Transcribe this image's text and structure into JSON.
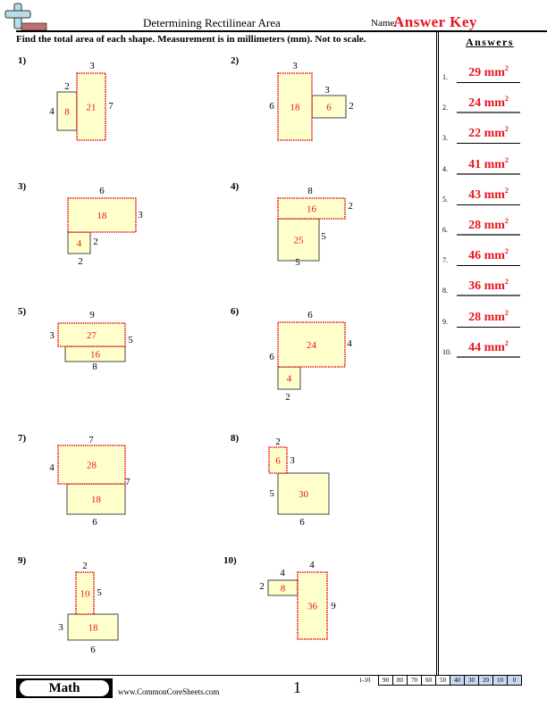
{
  "header": {
    "title": "Determining Rectilinear Area",
    "name_label": "Name:",
    "name_value": "Answer Key",
    "logo_icon": "plus-and-minus-blocks-icon"
  },
  "instructions": "Find the total area of each shape. Measurement is in millimeters (mm). Not to scale.",
  "colors": {
    "accent_red": "#e8141e",
    "shape_fill": "#ffffcc",
    "score_highlight": "#c6d9f1"
  },
  "problems": [
    {
      "label": "1)",
      "rects": [
        {
          "area": "21",
          "highlight": true
        },
        {
          "area": "8",
          "highlight": false
        }
      ],
      "dims": [
        "3",
        "2",
        "4",
        "7"
      ]
    },
    {
      "label": "2)",
      "rects": [
        {
          "area": "18",
          "highlight": true
        },
        {
          "area": "6",
          "highlight": false
        }
      ],
      "dims": [
        "3",
        "3",
        "6",
        "2"
      ]
    },
    {
      "label": "3)",
      "rects": [
        {
          "area": "18",
          "highlight": true
        },
        {
          "area": "4",
          "highlight": false
        }
      ],
      "dims": [
        "6",
        "3",
        "2",
        "2"
      ]
    },
    {
      "label": "4)",
      "rects": [
        {
          "area": "16",
          "highlight": true
        },
        {
          "area": "25",
          "highlight": false
        }
      ],
      "dims": [
        "8",
        "2",
        "5",
        "5"
      ]
    },
    {
      "label": "5)",
      "rects": [
        {
          "area": "27",
          "highlight": true
        },
        {
          "area": "16",
          "highlight": false
        }
      ],
      "dims": [
        "9",
        "3",
        "5",
        "8"
      ]
    },
    {
      "label": "6)",
      "rects": [
        {
          "area": "24",
          "highlight": true
        },
        {
          "area": "4",
          "highlight": false
        }
      ],
      "dims": [
        "6",
        "4",
        "6",
        "2"
      ]
    },
    {
      "label": "7)",
      "rects": [
        {
          "area": "28",
          "highlight": true
        },
        {
          "area": "18",
          "highlight": false
        }
      ],
      "dims": [
        "7",
        "4",
        "7",
        "6"
      ]
    },
    {
      "label": "8)",
      "rects": [
        {
          "area": "6",
          "highlight": true
        },
        {
          "area": "30",
          "highlight": false
        }
      ],
      "dims": [
        "2",
        "3",
        "5",
        "6"
      ]
    },
    {
      "label": "9)",
      "rects": [
        {
          "area": "10",
          "highlight": true
        },
        {
          "area": "18",
          "highlight": false
        }
      ],
      "dims": [
        "2",
        "5",
        "3",
        "6"
      ]
    },
    {
      "label": "10)",
      "rects": [
        {
          "area": "36",
          "highlight": true
        },
        {
          "area": "8",
          "highlight": false
        }
      ],
      "dims": [
        "4",
        "4",
        "2",
        "9"
      ]
    }
  ],
  "answers": {
    "heading": "Answers",
    "unit": "mm",
    "exponent": "2",
    "items": [
      {
        "num": "1.",
        "value": "29"
      },
      {
        "num": "2.",
        "value": "24"
      },
      {
        "num": "3.",
        "value": "22"
      },
      {
        "num": "4.",
        "value": "41"
      },
      {
        "num": "5.",
        "value": "43"
      },
      {
        "num": "6.",
        "value": "28"
      },
      {
        "num": "7.",
        "value": "46"
      },
      {
        "num": "8.",
        "value": "36"
      },
      {
        "num": "9.",
        "value": "28"
      },
      {
        "num": "10.",
        "value": "44"
      }
    ]
  },
  "footer": {
    "subject": "Math",
    "website": "www.CommonCoreSheets.com",
    "page": "1",
    "score_label": "1-10",
    "scores": [
      "90",
      "80",
      "70",
      "60",
      "50",
      "40",
      "30",
      "20",
      "10",
      "0"
    ],
    "highlighted_from_index": 5
  }
}
